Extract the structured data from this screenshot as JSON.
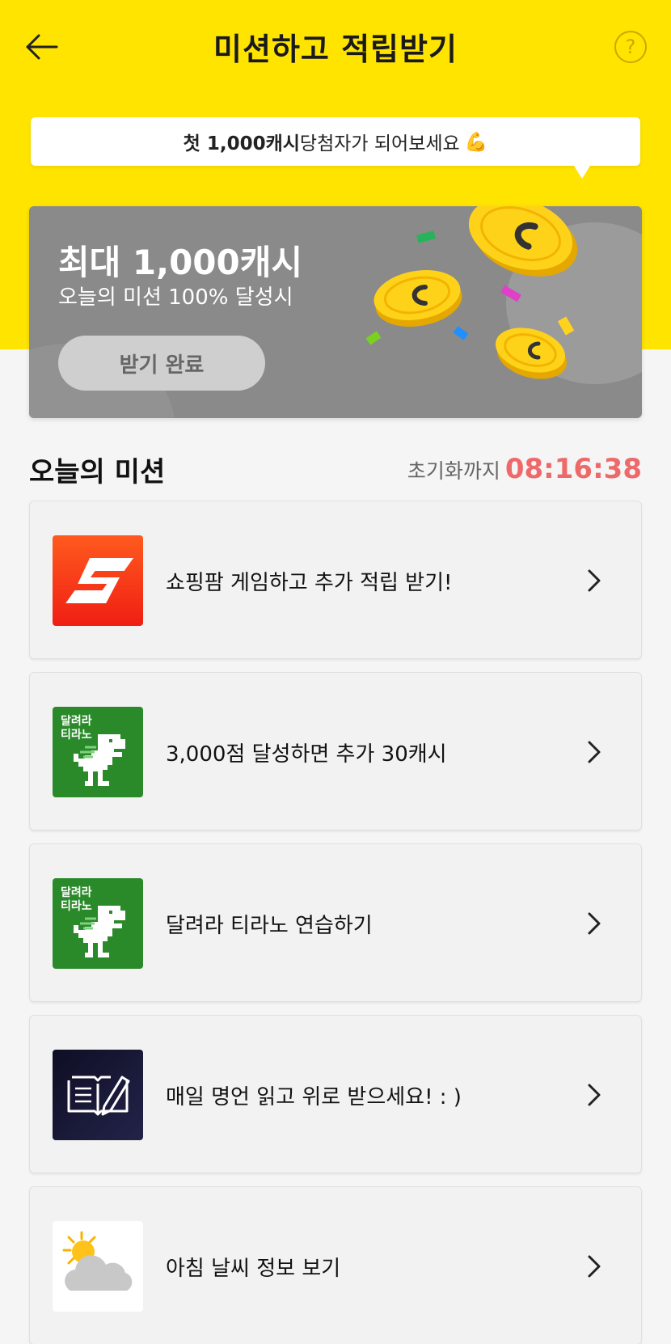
{
  "header": {
    "title": "미션하고 적립받기",
    "help_symbol": "?"
  },
  "tooltip": {
    "bold_part": "첫 1,000캐시",
    "rest": " 당첨자가 되어보세요",
    "emoji": "💪"
  },
  "reward": {
    "title": "최대 1,000캐시",
    "subtitle": "오늘의 미션 100% 달성시",
    "button_label": "받기 완료"
  },
  "missions_section": {
    "title": "오늘의 미션",
    "reset_label": "초기화까지",
    "reset_timer": "08:16:38"
  },
  "missions": [
    {
      "label": "쇼핑팜 게임하고 추가 적립 받기!",
      "icon": "shopping-farm-icon"
    },
    {
      "label": "3,000점 달성하면 추가 30캐시",
      "icon": "dino-run-icon",
      "icon_text": "달려라 티라노"
    },
    {
      "label": "달려라 티라노 연습하기",
      "icon": "dino-run-icon",
      "icon_text": "달려라 티라노"
    },
    {
      "label": "매일 명언 읽고 위로 받으세요! : )",
      "icon": "book-pen-icon"
    },
    {
      "label": "아침 날씨 정보 보기",
      "icon": "weather-icon"
    }
  ],
  "colors": {
    "brand_yellow": "#ffe400",
    "timer_red": "#ee6a6a",
    "card_gray": "#8a8a8a"
  }
}
